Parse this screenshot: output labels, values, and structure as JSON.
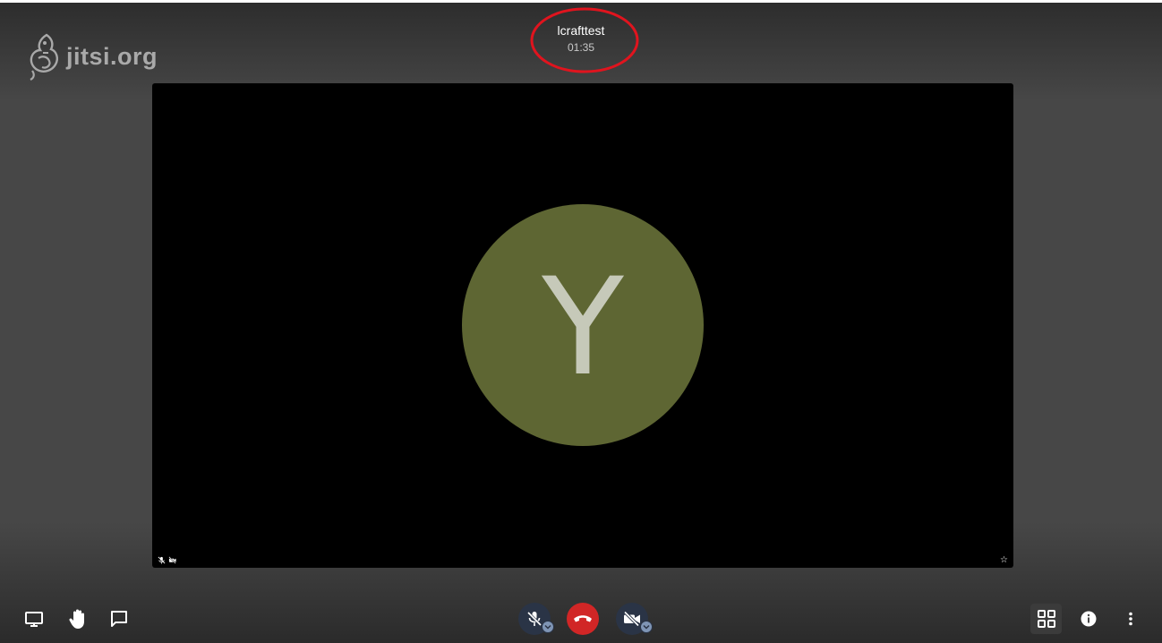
{
  "app": {
    "logo_text": "jitsi.org"
  },
  "meeting": {
    "name": "lcrafttest",
    "timer": "01:35"
  },
  "participant": {
    "avatar_initial": "Y",
    "star": "☆"
  },
  "colors": {
    "avatar_bg": "#5e6633",
    "hangup": "#d12626",
    "highlight_ring": "#e0141e",
    "toolbar_circle": "#2a3446",
    "chevron_badge": "#7f95b5"
  },
  "toolbar": {
    "left": [
      {
        "id": "share-screen",
        "icon": "monitor-icon"
      },
      {
        "id": "raise-hand",
        "icon": "hand-icon"
      },
      {
        "id": "chat",
        "icon": "chat-icon"
      }
    ],
    "center": [
      {
        "id": "microphone",
        "icon": "mic-off-icon",
        "state": "muted"
      },
      {
        "id": "hangup",
        "icon": "phone-hangup-icon"
      },
      {
        "id": "camera",
        "icon": "camera-off-icon",
        "state": "off"
      }
    ],
    "right": [
      {
        "id": "tile-view",
        "icon": "grid-icon"
      },
      {
        "id": "info",
        "icon": "info-icon"
      },
      {
        "id": "more",
        "icon": "more-vertical-icon"
      }
    ]
  }
}
